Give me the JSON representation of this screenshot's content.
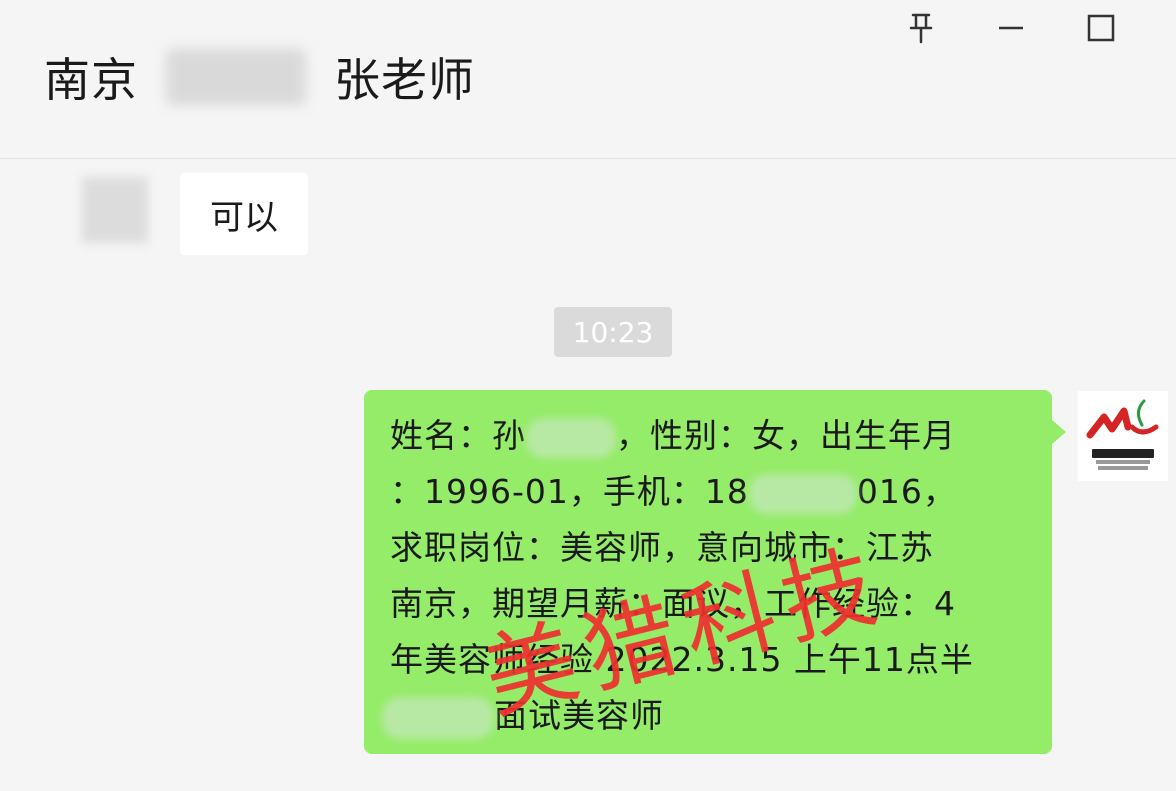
{
  "window": {
    "controls": {
      "pin": "pin-icon",
      "minimize": "minimize-icon",
      "maximize": "maximize-icon"
    }
  },
  "header": {
    "title_prefix": "南京",
    "title_suffix": "张老师"
  },
  "messages": [
    {
      "side": "left",
      "text": "可以"
    },
    {
      "type": "timestamp",
      "text": "10:23"
    },
    {
      "side": "right",
      "lines": [
        "姓名：孙",
        "，性别：女，出生年月",
        "：1996-01，手机：18",
        "016，",
        "求职岗位：美容师，意向城市：江苏",
        "南京，期望月薪：面议，工作经验：4",
        "年美容师经验 2022.3.15 上午11点半",
        "面试美容师"
      ],
      "watermark": "美猎科技"
    }
  ],
  "colors": {
    "background": "#f5f5f5",
    "self_bubble": "#95ec69",
    "other_bubble": "#ffffff",
    "watermark": "#ee2f2f"
  }
}
